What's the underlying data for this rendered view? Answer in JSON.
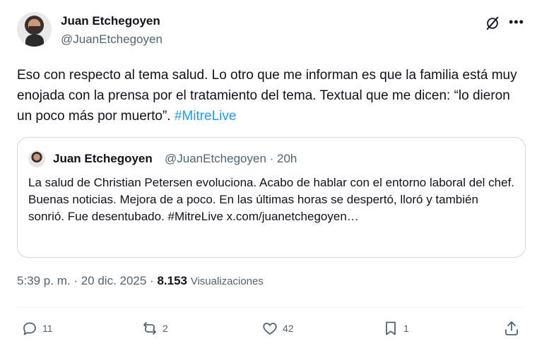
{
  "author": {
    "name": "Juan Etchegoyen",
    "handle": "@JuanEtchegoyen"
  },
  "tweet": {
    "text": "Eso con respecto al tema salud. Lo otro que me informan es que la familia está muy enojada con la prensa por el tratamiento del tema. Textual que me dicen: “lo dieron un poco más por muerto”. ",
    "hashtag": "#MitreLive"
  },
  "quoted": {
    "name": "Juan Etchegoyen",
    "handle_time": "@JuanEtchegoyen · 20h",
    "text": "La salud de Christian Petersen evoluciona. Acabo de hablar con el entorno laboral del chef. Buenas noticias. Mejora de a poco. En las últimas horas se despertó, lloró y también sonrió. Fue desentubado. #MitreLive x.com/juanetchegoyen…"
  },
  "meta": {
    "timestamp": "5:39 p. m. · 20 dic. 2025 · ",
    "views_count": "8.153",
    "views_label": "Visualizaciones"
  },
  "actions": {
    "replies": "11",
    "reposts": "2",
    "likes": "42",
    "bookmarks": "1"
  },
  "icons": [
    "grok-icon",
    "more-icon",
    "reply-icon",
    "repost-icon",
    "like-icon",
    "bookmark-icon",
    "share-icon"
  ],
  "colors": {
    "link": "#1d9bf0",
    "secondary": "#536471",
    "border": "#cfd9de"
  }
}
